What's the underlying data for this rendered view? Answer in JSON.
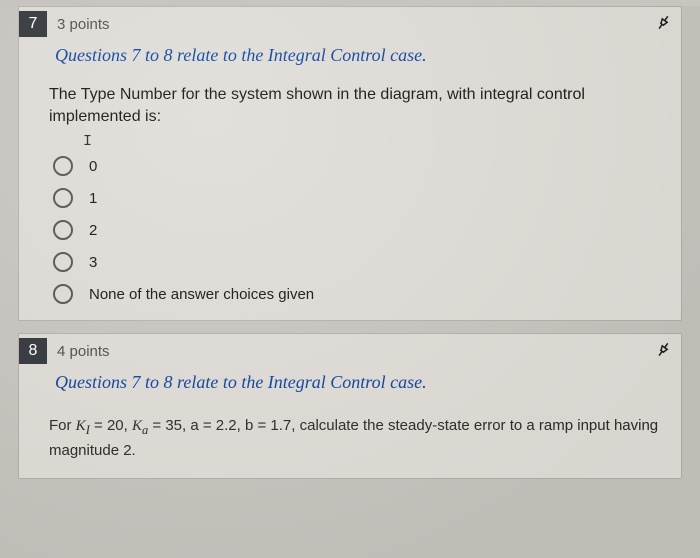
{
  "q7": {
    "number": "7",
    "points": "3 points",
    "section_note": "Questions 7 to 8 relate to the Integral Control case.",
    "text": "The Type Number for the system shown in the diagram, with integral control implemented is:",
    "cursor": "I",
    "options": [
      "0",
      "1",
      "2",
      "3",
      "None of the answer choices given"
    ]
  },
  "q8": {
    "number": "8",
    "points": "4 points",
    "section_note": "Questions 7 to 8 relate to the Integral Control case.",
    "params_prefix": "For ",
    "KI_label": "K",
    "KI_sub": "I",
    "KI_val": " = 20,  ",
    "Ka_label": "K",
    "Ka_sub": "a",
    "Ka_val": " = 35,  a = 2.2,  b = 1.7, calculate the steady-state error to a ramp input having magnitude 2."
  }
}
